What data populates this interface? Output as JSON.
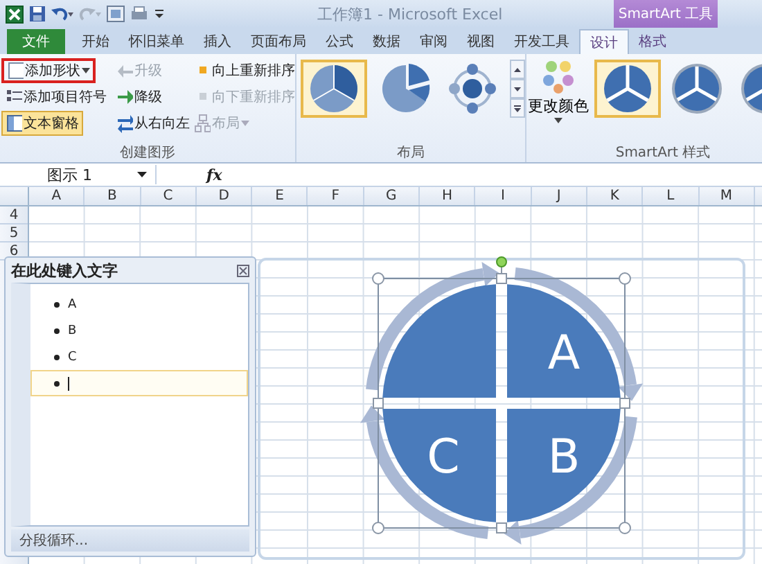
{
  "window": {
    "title": "工作簿1 - Microsoft Excel",
    "contextual_group": "SmartArt 工具"
  },
  "tabs": [
    {
      "label": "文件",
      "kind": "file",
      "selected": false
    },
    {
      "label": "开始",
      "kind": "normal",
      "selected": false
    },
    {
      "label": "怀旧菜单",
      "kind": "normal",
      "selected": false
    },
    {
      "label": "插入",
      "kind": "normal",
      "selected": false
    },
    {
      "label": "页面布局",
      "kind": "normal",
      "selected": false
    },
    {
      "label": "公式",
      "kind": "normal",
      "selected": false
    },
    {
      "label": "数据",
      "kind": "normal",
      "selected": false
    },
    {
      "label": "审阅",
      "kind": "normal",
      "selected": false
    },
    {
      "label": "视图",
      "kind": "normal",
      "selected": false
    },
    {
      "label": "开发工具",
      "kind": "normal",
      "selected": false
    },
    {
      "label": "设计",
      "kind": "contextual",
      "selected": true
    },
    {
      "label": "格式",
      "kind": "contextual",
      "selected": false
    }
  ],
  "ribbon": {
    "create_group": {
      "label": "创建图形",
      "commands": [
        {
          "label": "添加形状",
          "dropdown": true,
          "disabled": false,
          "pressed": false,
          "outlined": true
        },
        {
          "label": "添加项目符号",
          "dropdown": false,
          "disabled": false,
          "pressed": false,
          "outlined": false
        },
        {
          "label": "文本窗格",
          "dropdown": false,
          "disabled": false,
          "pressed": true,
          "outlined": false
        },
        {
          "label": "升级",
          "dropdown": false,
          "disabled": true,
          "pressed": false,
          "outlined": false
        },
        {
          "label": "降级",
          "dropdown": false,
          "disabled": false,
          "pressed": false,
          "outlined": false
        },
        {
          "label": "从右向左",
          "dropdown": false,
          "disabled": false,
          "pressed": false,
          "outlined": false
        },
        {
          "label": "向上重新排序",
          "dropdown": false,
          "disabled": false,
          "pressed": false,
          "outlined": false
        },
        {
          "label": "向下重新排序",
          "dropdown": false,
          "disabled": true,
          "pressed": false,
          "outlined": false
        },
        {
          "label": "布局",
          "dropdown": true,
          "disabled": true,
          "pressed": false,
          "outlined": false
        }
      ]
    },
    "layout_group": {
      "label": "布局",
      "layouts": [
        {
          "kind": "pie",
          "selected": true
        },
        {
          "kind": "pie-cut",
          "selected": false
        },
        {
          "kind": "hub",
          "selected": false
        }
      ]
    },
    "styles_group": {
      "label": "SmartArt 样式",
      "change_colors": "更改颜色",
      "styles": [
        {
          "kind": "flat",
          "selected": true
        },
        {
          "kind": "bevel",
          "selected": false
        },
        {
          "kind": "bevel",
          "selected": false
        }
      ]
    }
  },
  "formula_bar": {
    "name_box": "图示 1",
    "fx": "fx"
  },
  "sheet": {
    "columns": [
      "A",
      "B",
      "C",
      "D",
      "E",
      "F",
      "G",
      "H",
      "I",
      "J",
      "K",
      "L",
      "M"
    ],
    "rows": [
      "4",
      "5",
      "6"
    ]
  },
  "text_pane": {
    "title": "在此处键入文字",
    "items": [
      {
        "text": "A",
        "selected": false
      },
      {
        "text": "B",
        "selected": false
      },
      {
        "text": "C",
        "selected": false
      },
      {
        "selected": true
      }
    ],
    "footer": "分段循环..."
  },
  "diagram": {
    "segments": [
      {
        "kind": "quadrant",
        "text": "A"
      },
      {
        "kind": "quadrant",
        "text": "B"
      },
      {
        "kind": "quadrant",
        "text": "C"
      },
      {
        "kind": "quadrant"
      }
    ]
  }
}
